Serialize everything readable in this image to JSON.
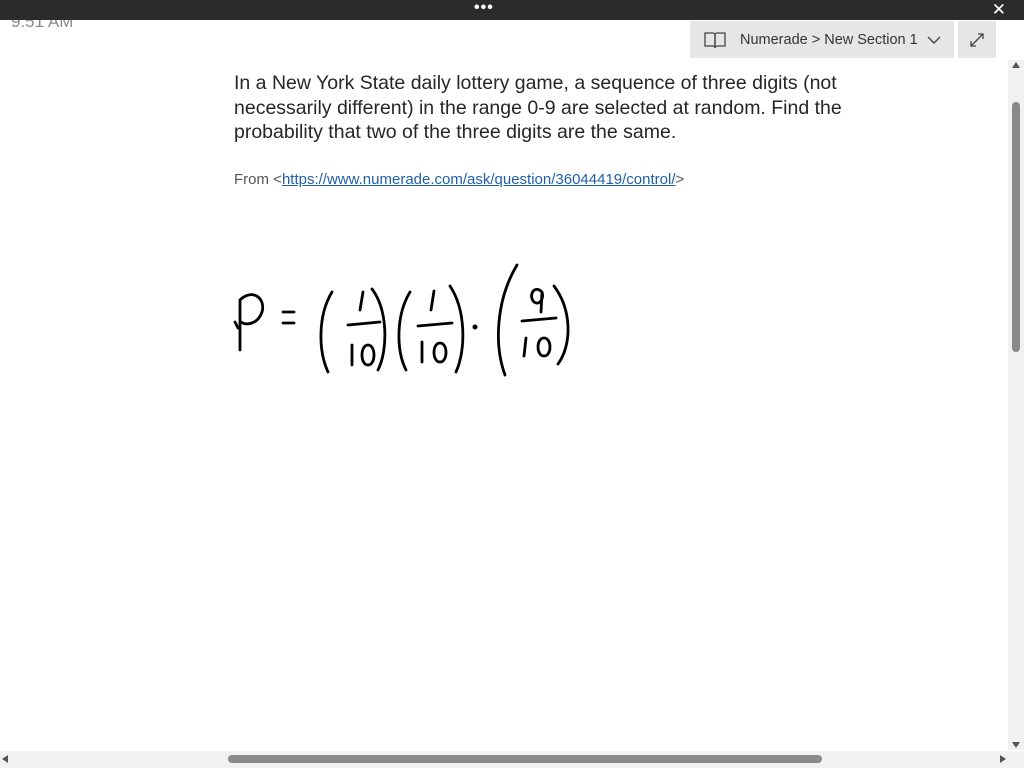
{
  "window": {
    "more_label": "•••",
    "close_label": "✕",
    "clock": "9:51 AM"
  },
  "notebook": {
    "breadcrumb": "Numerade > New Section 1",
    "icons": {
      "notebook": "notebook-icon",
      "dropdown": "chevron-down-icon",
      "expand": "expand-icon"
    }
  },
  "page": {
    "question": "In a New York State daily lottery game, a sequence of three digits (not necessarily different) in the range 0-9 are selected at random. Find the probability that two of the three digits are the same.",
    "source_prefix": "From <",
    "source_url": "https://www.numerade.com/ask/question/36044419/control/",
    "source_suffix": ">"
  },
  "handwriting": {
    "lhs": "P",
    "equals": "=",
    "factors": [
      {
        "numerator": "1",
        "denominator": "10"
      },
      {
        "numerator": "1",
        "denominator": "10"
      },
      {
        "numerator": "9",
        "denominator": "10"
      }
    ],
    "dot": "•"
  }
}
